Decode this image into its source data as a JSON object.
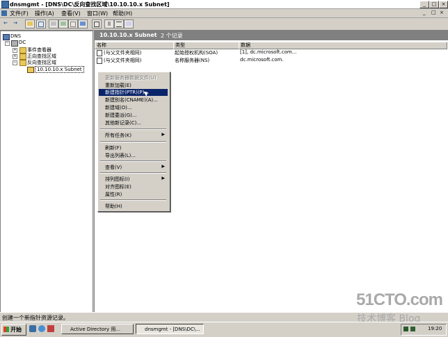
{
  "window": {
    "title": "dnsmgmt - [DNS\\DC\\反向查找区域\\10.10.10.x Subnet]",
    "min": "_",
    "max": "□",
    "close": "×"
  },
  "menubar": {
    "items": [
      "文件(F)",
      "操作(A)",
      "查看(V)",
      "窗口(W)",
      "帮助(H)"
    ],
    "mdi_min": "_",
    "mdi_max": "□",
    "mdi_close": "×"
  },
  "toolbar": {
    "back": "←",
    "forward": "→"
  },
  "tree": {
    "root": "DNS",
    "server": "DC",
    "children": [
      "事件查看器",
      "正向查找区域",
      "反向查找区域"
    ],
    "selected": "10.10.10.x Subnet",
    "expand_plus": "+",
    "expand_minus": "−"
  },
  "zone_header": {
    "name": "10.10.10.x Subnet",
    "count": "2 个记录"
  },
  "columns": [
    "名称",
    "类型",
    "数据"
  ],
  "records": [
    {
      "name": "(与父文件夹相同)",
      "type": "起始授权机构(SOA)",
      "data": "[1], dc.microsoft.com..."
    },
    {
      "name": "(与父文件夹相同)",
      "type": "名称服务器(NS)",
      "data": "dc.microsoft.com."
    }
  ],
  "context_menu": {
    "update": "更新服务器数据文件(U)",
    "reload": "重新加载(E)",
    "new_ptr": "新建指针(PTR)(P)...",
    "new_cname": "新建别名(CNAME)(A)...",
    "new_domain": "新建域(O)...",
    "new_delegation": "新建委派(G)...",
    "other_records": "其他新记录(C)...",
    "all_tasks": "所有任务(K)",
    "refresh": "刷新(F)",
    "export": "导出列表(L)...",
    "view": "查看(V)",
    "arrange": "排列图标(I)",
    "line_up": "对齐图标(E)",
    "properties": "属性(R)",
    "help": "帮助(H)",
    "submenu_arrow": "▶"
  },
  "status": "创建一个新指针资源记录。",
  "taskbar": {
    "start": "开始",
    "tasks": [
      "Active Directory 用...",
      "dnsmgmt - [DNS\\DC\\..."
    ],
    "clock": "19:20"
  },
  "watermark": {
    "line1": "51CTO.com",
    "line2": "技术博客  Blog"
  },
  "colors": {
    "highlight": "#0a246a",
    "header_gray": "#808080",
    "face": "#d4d0c8"
  }
}
